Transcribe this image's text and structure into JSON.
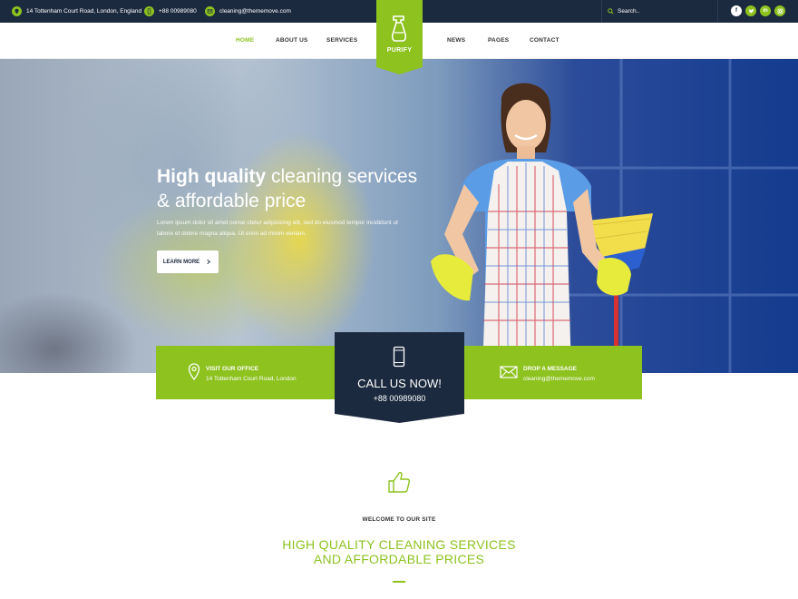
{
  "colors": {
    "accent": "#8dc21f",
    "dark": "#1c2a3f",
    "white": "#ffffff"
  },
  "topbar": {
    "address": "14 Tottenham Court Road, London, England",
    "phone": "+88 00989080",
    "email": "cleaning@thememove.com",
    "search_placeholder": "Search..",
    "social": [
      "facebook-icon",
      "twitter-icon",
      "linkedin-icon",
      "instagram-icon"
    ]
  },
  "nav": {
    "items": [
      "HOME",
      "ABOUT US",
      "SERVICES",
      "NEWS",
      "PAGES",
      "CONTACT"
    ],
    "active": "HOME",
    "logo_text": "PURIFY"
  },
  "hero": {
    "title_bold": "High quality",
    "title_rest": " cleaning services & affordable price",
    "description": "Lorem ipsum dolor sit amet conse ctetur adipisicing elit, sed do eiusmod tempor incididunt ut labore et dolore magna aliqua. Ut enim ad minim veniam.",
    "button_label": "LEARN MORE"
  },
  "contact": {
    "office_label": "VISIT OUR OFFICE",
    "office_value": "14 Tottenham Court Road, London",
    "call_title": "CALL US NOW!",
    "call_number": "+88 00989080",
    "message_label": "DROP A MESSAGE",
    "message_value": "cleaning@thememove.com"
  },
  "welcome": {
    "subtitle": "WELCOME TO OUR SITE",
    "title_line1": "HIGH QUALITY CLEANING SERVICES",
    "title_line2": "AND AFFORDABLE PRICES"
  }
}
